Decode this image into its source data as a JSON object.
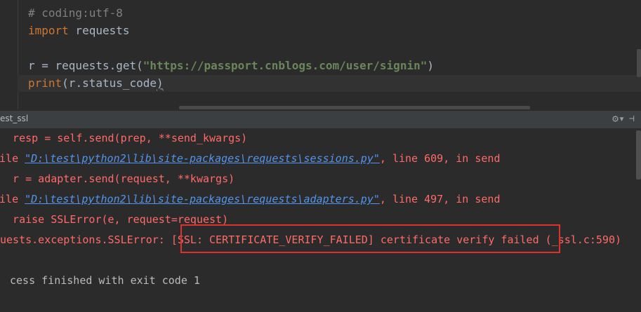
{
  "editor": {
    "line1": "# coding:utf-8",
    "line2_kw": "import",
    "line2_rest": " requests",
    "line4_a": "r = requests.get(",
    "line4_str": "\"https://passport.cnblogs.com/user/signin\"",
    "line4_b": ")",
    "line5_kw": "print",
    "line5_rest": "(r.status_code",
    "line5_end": ")"
  },
  "run_panel": {
    "title": "est_ssl",
    "gear_icon": "gear-icon",
    "layout_icon": "layout-icon"
  },
  "console": {
    "l1": "  resp = self.send(prep, **send_kwargs)",
    "l2_a": "File ",
    "l2_link": "\"D:\\test\\python2\\lib\\site-packages\\requests\\sessions.py\"",
    "l2_b": ", line 609, in send",
    "l3": "  r = adapter.send(request, **kwargs)",
    "l4_a": "File ",
    "l4_link": "\"D:\\test\\python2\\lib\\site-packages\\requests\\adapters.py\"",
    "l4_b": ", line 497, in send",
    "l5": "  raise SSLError(e, request=request)",
    "l6": "uests.exceptions.SSLError: [SSL: CERTIFICATE_VERIFY_FAILED] certificate verify failed (_ssl.c:590)",
    "l8": "cess finished with exit code 1"
  }
}
